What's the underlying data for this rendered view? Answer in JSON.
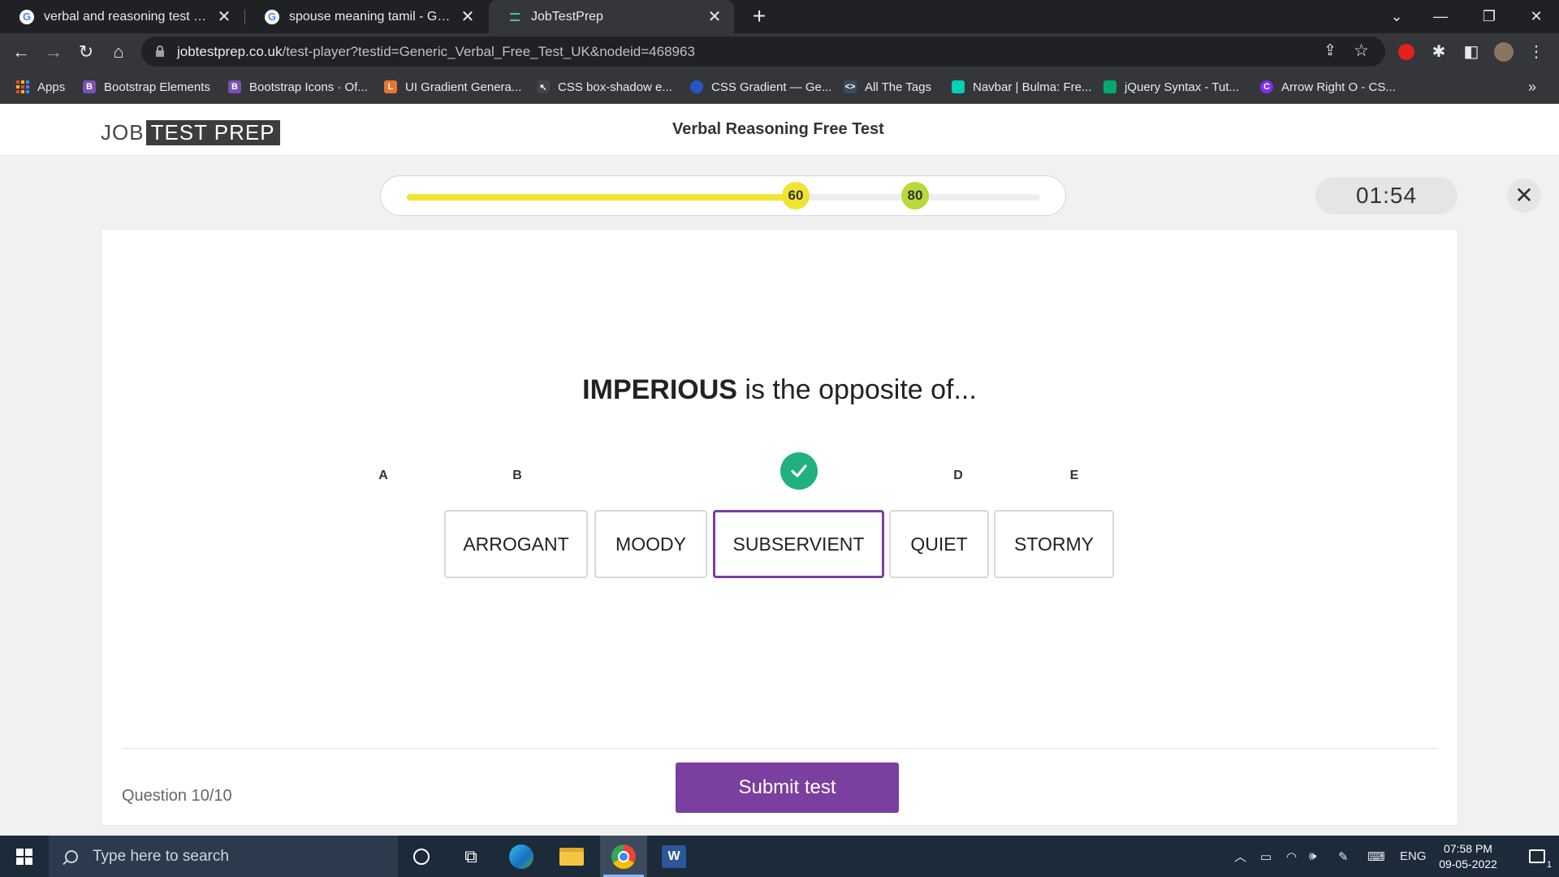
{
  "browser": {
    "tabs": [
      {
        "title": "verbal and reasoning test - Goog",
        "icon": "google-icon",
        "active": false
      },
      {
        "title": "spouse meaning tamil - Google S",
        "icon": "google-icon",
        "active": false
      },
      {
        "title": "JobTestPrep",
        "icon": "jobtestprep-icon",
        "active": true
      }
    ],
    "url_host": "jobtestprep.co.uk",
    "url_path": "/test-player?testid=Generic_Verbal_Free_Test_UK&nodeid=468963",
    "bookmarks": [
      {
        "label": "Apps",
        "icon": "apps-grid-icon"
      },
      {
        "label": "Bootstrap Elements",
        "icon": "bootstrap-icon",
        "color": "#7952b3"
      },
      {
        "label": "Bootstrap Icons · Of...",
        "icon": "bootstrap-icon",
        "color": "#7952b3"
      },
      {
        "label": "UI Gradient Genera...",
        "icon": "ui-gradient-icon",
        "color": "#e8762d"
      },
      {
        "label": "CSS box-shadow e...",
        "icon": "cursor-icon",
        "color": "#444444"
      },
      {
        "label": "CSS Gradient — Ge...",
        "icon": "css-gradient-icon",
        "color": "#2457c5"
      },
      {
        "label": "All The Tags",
        "icon": "code-icon",
        "color": "#3c4a5c"
      },
      {
        "label": "Navbar | Bulma: Fre...",
        "icon": "bulma-icon",
        "color": "#00d1b2"
      },
      {
        "label": "jQuery Syntax - Tut...",
        "icon": "jquery-icon",
        "color": "#04aa6d"
      },
      {
        "label": "Arrow Right O - CS...",
        "icon": "css-gg-icon",
        "color": "#7b2ff7"
      }
    ]
  },
  "site": {
    "logo_job": "JOB",
    "logo_testprep": "TEST PREP",
    "title": "Verbal Reasoning Free Test"
  },
  "progress": {
    "value": 60,
    "markers": [
      "60",
      "80"
    ],
    "accent": "#f0e431",
    "marker2_color": "#b8d93a"
  },
  "timer": "01:54",
  "question": {
    "keyword": "IMPERIOUS",
    "rest": " is the opposite of..."
  },
  "options": [
    {
      "letter": "A",
      "text": "ARROGANT",
      "selected": false
    },
    {
      "letter": "B",
      "text": "MOODY",
      "selected": false
    },
    {
      "letter": "C",
      "text": "SUBSERVIENT",
      "selected": true
    },
    {
      "letter": "D",
      "text": "QUIET",
      "selected": false
    },
    {
      "letter": "E",
      "text": "STORMY",
      "selected": false
    }
  ],
  "footer": {
    "question_count": "Question 10/10",
    "submit_label": "Submit test"
  },
  "colors": {
    "brand_purple": "#7b3fa0",
    "check_green": "#21b07f"
  },
  "taskbar": {
    "search_placeholder": "Type here to search",
    "language": "ENG",
    "time": "07:58 PM",
    "date": "09-05-2022",
    "notification_count": "1"
  }
}
